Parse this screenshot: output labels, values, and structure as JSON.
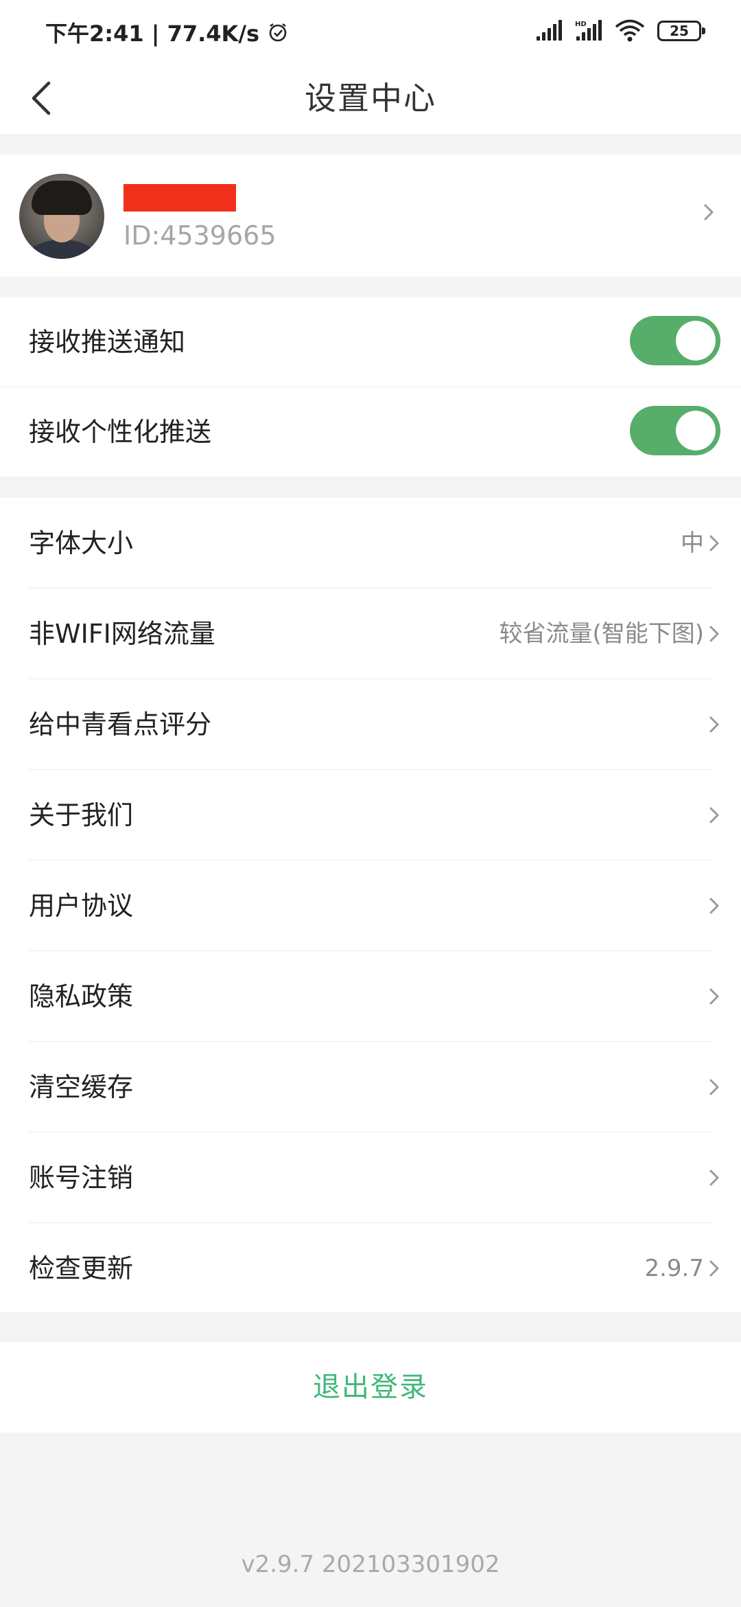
{
  "status_bar": {
    "time_speed": "下午2:41 | 77.4K/s",
    "battery": "25",
    "icons": [
      "alarm-icon",
      "signal-icon",
      "signal-hd-icon",
      "wifi-icon",
      "battery-icon"
    ]
  },
  "header": {
    "title": "设置中心",
    "back_icon": "chevron-left-icon"
  },
  "profile": {
    "user_id": "ID:4539665"
  },
  "toggles": [
    {
      "label": "接收推送通知",
      "on": true
    },
    {
      "label": "接收个性化推送",
      "on": true
    }
  ],
  "menu": [
    {
      "label": "字体大小",
      "value": "中"
    },
    {
      "label": "非WIFI网络流量",
      "value": "较省流量(智能下图)"
    },
    {
      "label": "给中青看点评分",
      "value": ""
    },
    {
      "label": "关于我们",
      "value": ""
    },
    {
      "label": "用户协议",
      "value": ""
    },
    {
      "label": "隐私政策",
      "value": ""
    },
    {
      "label": "清空缓存",
      "value": ""
    },
    {
      "label": "账号注销",
      "value": ""
    },
    {
      "label": "检查更新",
      "value": "2.9.7"
    }
  ],
  "logout_label": "退出登录",
  "version_footer": "v2.9.7 202103301902",
  "colors": {
    "accent_green": "#57ad6a",
    "logout_green": "#3fb878",
    "redaction": "#f1301b"
  }
}
